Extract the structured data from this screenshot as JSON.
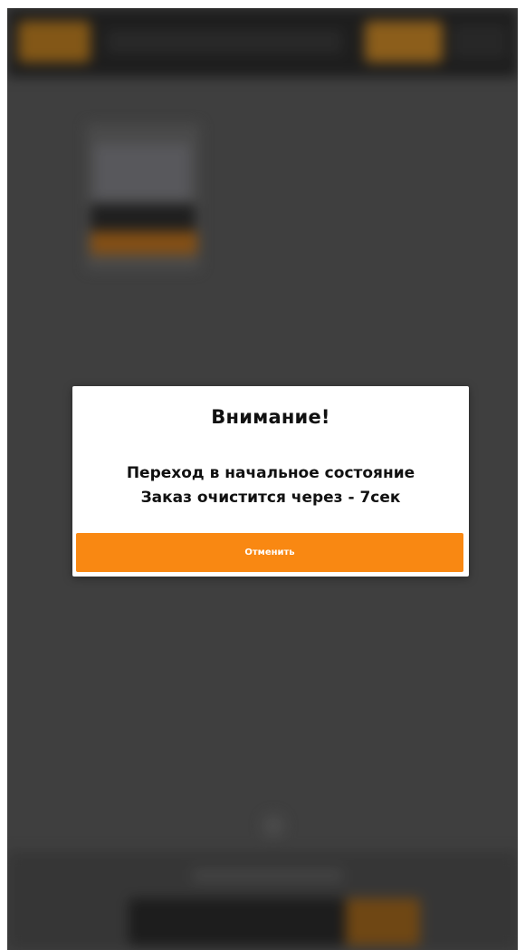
{
  "dialog": {
    "title": "Внимание!",
    "message_line1": "Переход в начальное состояние",
    "message_line2": "Заказ очистится через - 7сек",
    "cancel_label": "Отменить"
  },
  "colors": {
    "accent": "#f98812",
    "dialog_background": "#ffffff",
    "screen_background": "#4a4a4a",
    "text": "#111111"
  }
}
